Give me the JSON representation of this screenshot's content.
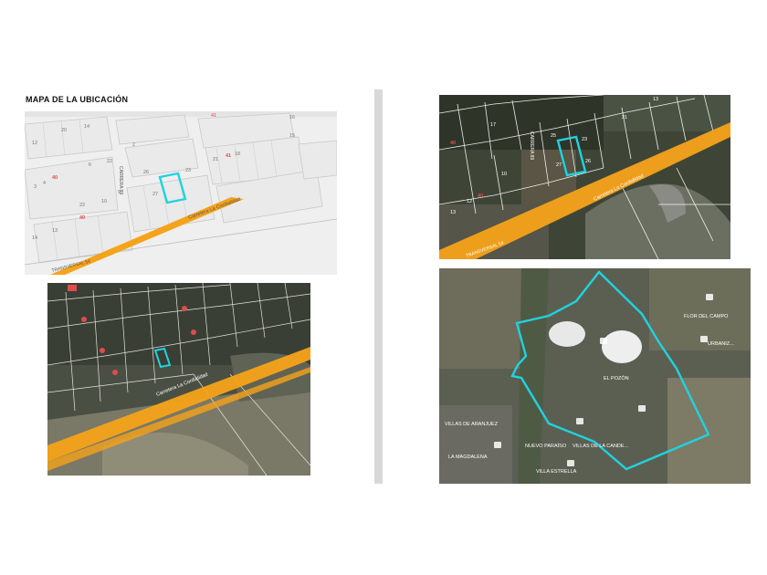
{
  "header": {
    "title": "MAPA DE LA UBICACIÓN"
  },
  "colors": {
    "parcel_highlight": "#1fd3e0",
    "road": "#f5a31a",
    "poi_red": "#e04c4c",
    "label_text": "#666666"
  },
  "map_street": {
    "street_labels": [
      "Carretera La Cordialidad",
      "TRANSVERSAL 54",
      "CARRERA 89"
    ],
    "lot_numbers": [
      "41",
      "12",
      "20",
      "14",
      "16",
      "15",
      "2",
      "3",
      "4",
      "6",
      "22",
      "40",
      "41",
      "26",
      "23",
      "21",
      "18",
      "27",
      "9",
      "10",
      "22",
      "13",
      "40",
      "14"
    ],
    "poi_numbers": [
      "41",
      "40",
      "41",
      "40"
    ]
  },
  "map_satellite_close": {
    "street_labels": [
      "Carretera La Cordialidad",
      "CARRERA 89",
      "TRANSVERSAL 54"
    ],
    "lot_numbers": [
      "13",
      "21",
      "17",
      "25",
      "23",
      "27",
      "26",
      "10",
      "12",
      "13",
      "40",
      "40"
    ]
  },
  "map_satellite_mid": {
    "street_labels": [
      "Carretera La Cordialidad"
    ]
  },
  "map_satellite_wide": {
    "place_labels": [
      "FLOR DEL CAMPO",
      "URBANIZ...",
      "EL POZÓN",
      "VILLAS DE LA CANDE...",
      "NUEVO PARAÍSO",
      "VILLA ESTRELLA",
      "VILLAS DE ARANJUEZ",
      "LA MAGDALENA"
    ]
  }
}
